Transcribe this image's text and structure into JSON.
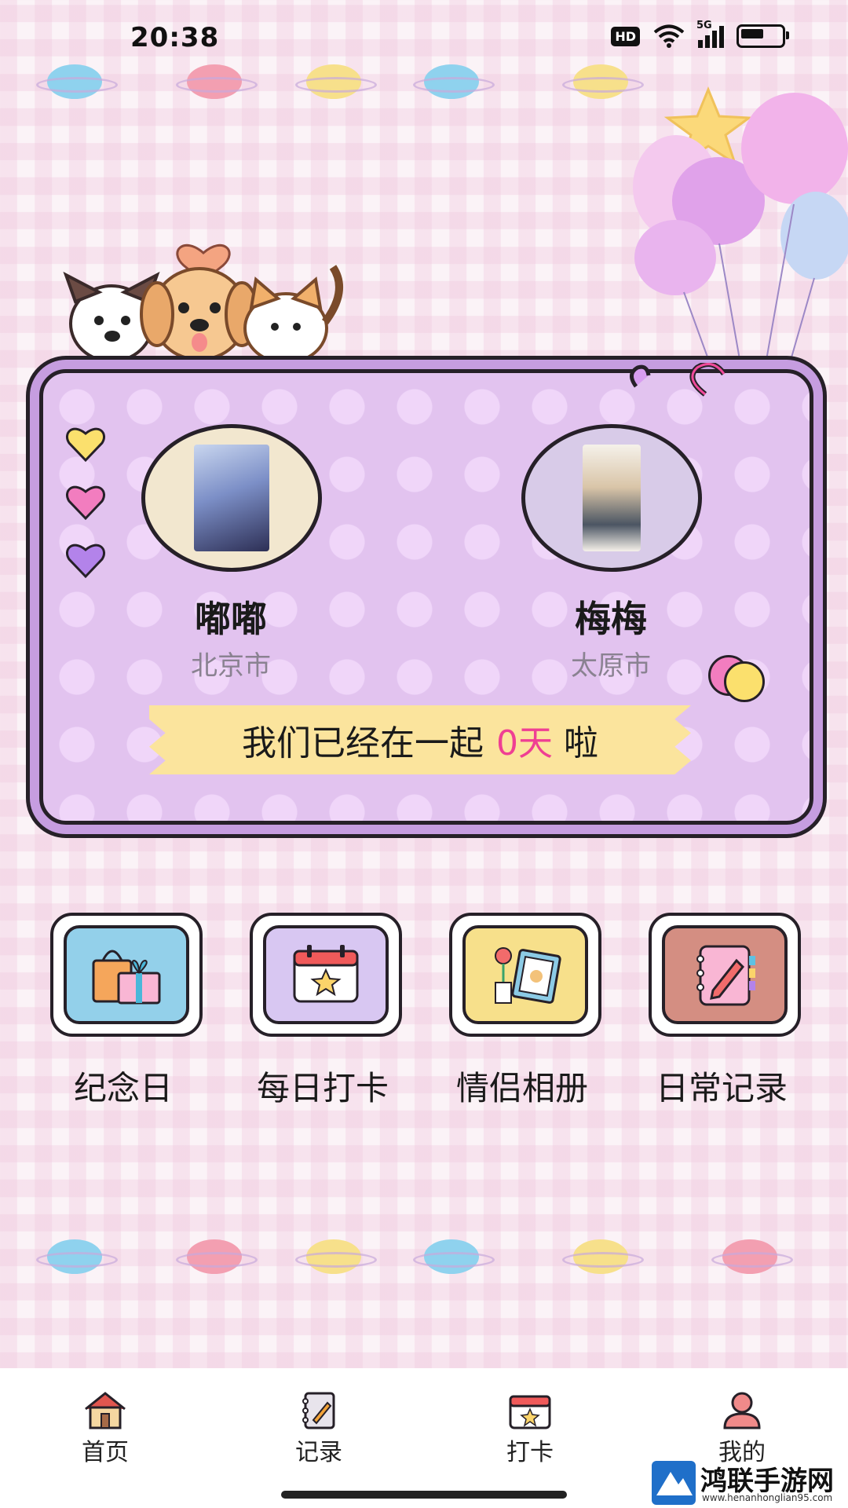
{
  "status_bar": {
    "time": "20:38",
    "hd": "HD",
    "network": "5G"
  },
  "couple": {
    "left": {
      "name": "嘟嘟",
      "city": "北京市"
    },
    "right": {
      "name": "梅梅",
      "city": "太原市"
    },
    "together_prefix": "我们已经在一起",
    "together_days": "0天",
    "together_suffix": "啦"
  },
  "features": [
    {
      "label": "纪念日",
      "icon": "gift-bag-icon",
      "color": "#93d0ea"
    },
    {
      "label": "每日打卡",
      "icon": "calendar-star-icon",
      "color": "#d8c7f2"
    },
    {
      "label": "情侣相册",
      "icon": "photo-frame-icon",
      "color": "#f7e08b"
    },
    {
      "label": "日常记录",
      "icon": "notebook-pen-icon",
      "color": "#d48e82"
    }
  ],
  "bottom_nav": [
    {
      "label": "首页",
      "icon": "house-icon"
    },
    {
      "label": "记录",
      "icon": "notebook-icon"
    },
    {
      "label": "打卡",
      "icon": "calendar-icon"
    },
    {
      "label": "我的",
      "icon": "person-icon"
    }
  ],
  "colors": {
    "card_bg": "#e2c3ef",
    "card_border": "#c69de0",
    "ribbon": "#fbe49d",
    "days_accent": "#ef3f93"
  },
  "watermark": {
    "text": "鸿联手游网",
    "url": "www.henanhonglian95.com"
  }
}
